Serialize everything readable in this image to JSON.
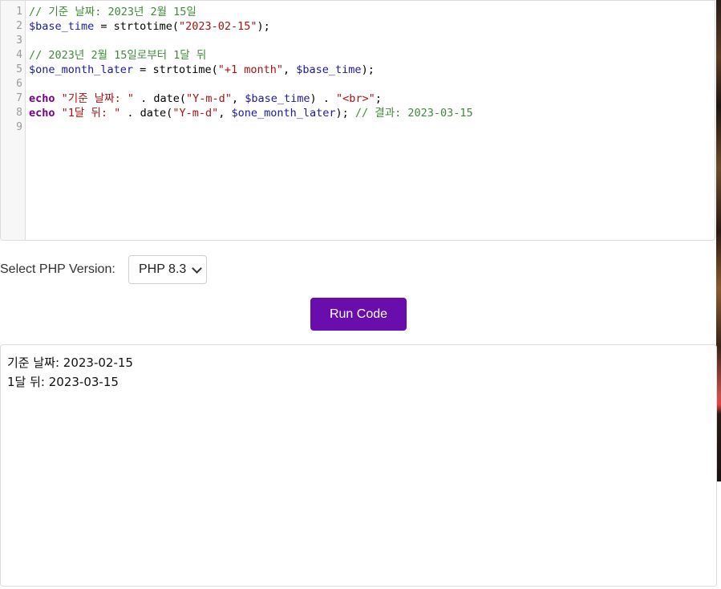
{
  "editor": {
    "line_numbers": [
      "1",
      "2",
      "3",
      "4",
      "5",
      "6",
      "7",
      "8",
      "9"
    ],
    "lines": [
      [
        {
          "t": "cm",
          "v": "// 기준 날짜: 2023년 2월 15일"
        }
      ],
      [
        {
          "t": "var",
          "v": "$base_time"
        },
        {
          "t": "op",
          "v": " = "
        },
        {
          "t": "fn",
          "v": "strtotime"
        },
        {
          "t": "op",
          "v": "("
        },
        {
          "t": "str",
          "v": "\"2023-02-15\""
        },
        {
          "t": "op",
          "v": ");"
        }
      ],
      [],
      [
        {
          "t": "cm",
          "v": "// 2023년 2월 15일로부터 1달 뒤"
        }
      ],
      [
        {
          "t": "var",
          "v": "$one_month_later"
        },
        {
          "t": "op",
          "v": " = "
        },
        {
          "t": "fn",
          "v": "strtotime"
        },
        {
          "t": "op",
          "v": "("
        },
        {
          "t": "str",
          "v": "\"+1 month\""
        },
        {
          "t": "op",
          "v": ", "
        },
        {
          "t": "var",
          "v": "$base_time"
        },
        {
          "t": "op",
          "v": ");"
        }
      ],
      [],
      [
        {
          "t": "kw",
          "v": "echo"
        },
        {
          "t": "op",
          "v": " "
        },
        {
          "t": "str",
          "v": "\"기준 날짜: \""
        },
        {
          "t": "op",
          "v": " . "
        },
        {
          "t": "fn",
          "v": "date"
        },
        {
          "t": "op",
          "v": "("
        },
        {
          "t": "str",
          "v": "\"Y-m-d\""
        },
        {
          "t": "op",
          "v": ", "
        },
        {
          "t": "var",
          "v": "$base_time"
        },
        {
          "t": "op",
          "v": ") . "
        },
        {
          "t": "str",
          "v": "\"<br>\""
        },
        {
          "t": "op",
          "v": ";"
        }
      ],
      [
        {
          "t": "kw",
          "v": "echo"
        },
        {
          "t": "op",
          "v": " "
        },
        {
          "t": "str",
          "v": "\"1달 뒤: \""
        },
        {
          "t": "op",
          "v": " . "
        },
        {
          "t": "fn",
          "v": "date"
        },
        {
          "t": "op",
          "v": "("
        },
        {
          "t": "str",
          "v": "\"Y-m-d\""
        },
        {
          "t": "op",
          "v": ", "
        },
        {
          "t": "var",
          "v": "$one_month_later"
        },
        {
          "t": "op",
          "v": "); "
        },
        {
          "t": "cm",
          "v": "// 결과: 2023-03-15"
        }
      ],
      []
    ]
  },
  "controls": {
    "php_version_label": "Select PHP Version:",
    "php_version_selected": "PHP 8.3",
    "run_button_label": "Run Code"
  },
  "output": {
    "lines": [
      "기준 날짜: 2023-02-15",
      "1달 뒤: 2023-03-15"
    ]
  }
}
